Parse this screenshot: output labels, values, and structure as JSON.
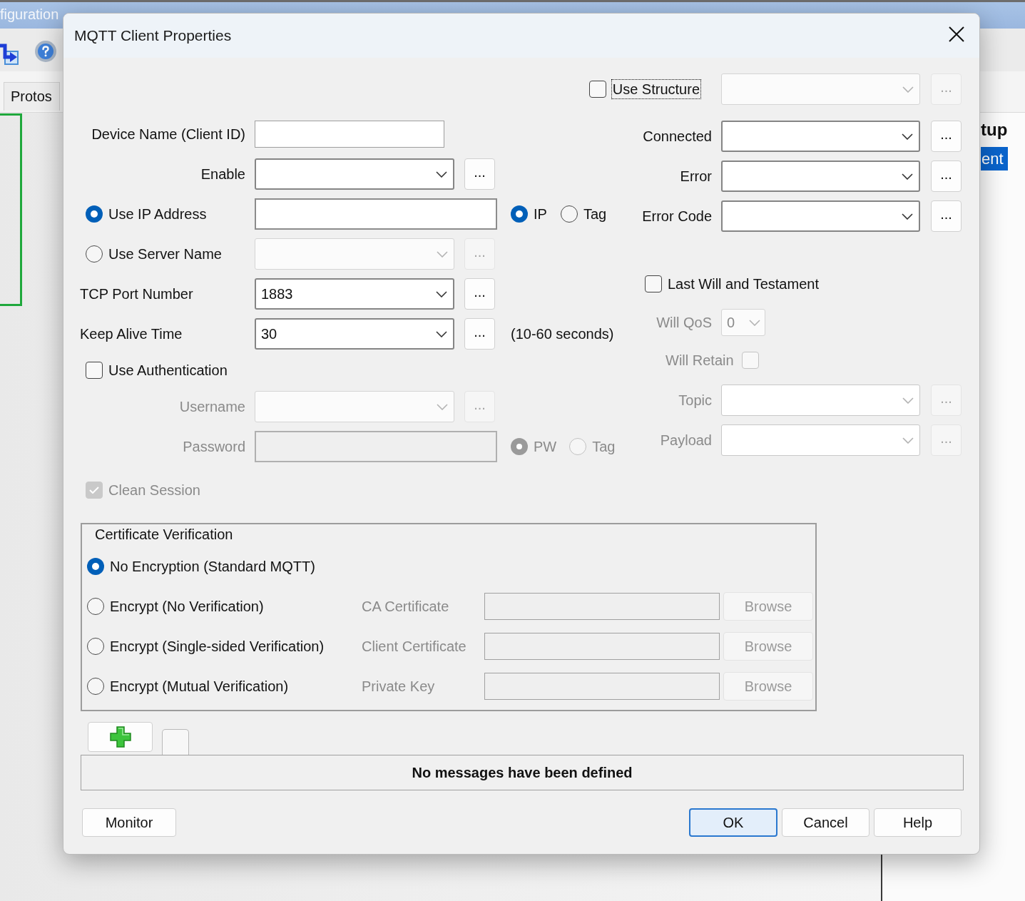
{
  "app": {
    "title": "figuration",
    "tab": "Protos",
    "panel": {
      "heading": "tup",
      "items": [
        {
          "label": "ent",
          "selected": true
        }
      ]
    }
  },
  "dialog": {
    "title": "MQTT Client Properties"
  },
  "use_structure": {
    "label": "Use Structure",
    "checked": false,
    "focused": true,
    "disabled": true,
    "browse": "..."
  },
  "device_name": {
    "label": "Device Name (Client ID)"
  },
  "enable": {
    "label": "Enable",
    "disabled": false,
    "browse": "..."
  },
  "address_mode": [
    {
      "label": "Use IP Address",
      "selected": true
    },
    {
      "label": "Use Server Name",
      "selected": false
    }
  ],
  "ip_address": {
    "format": [
      {
        "label": "IP",
        "selected": true
      },
      {
        "label": "Tag",
        "selected": false
      }
    ]
  },
  "server_name": {
    "disabled": true,
    "browse": "..."
  },
  "tcp_port": {
    "label": "TCP Port Number",
    "value": "1883",
    "disabled": false,
    "browse": "..."
  },
  "keep_alive": {
    "label": "Keep Alive Time",
    "value": "30",
    "disabled": false,
    "browse": "...",
    "hint": "(10-60 seconds)"
  },
  "use_authentication": {
    "label": "Use Authentication",
    "checked": false
  },
  "username": {
    "label": "Username",
    "disabled": true,
    "browse": "..."
  },
  "password": {
    "label": "Password",
    "disabled": true,
    "format": [
      {
        "label": "PW",
        "selected": true
      },
      {
        "label": "Tag",
        "selected": false
      }
    ]
  },
  "clean_session": {
    "label": "Clean Session",
    "checked": true,
    "disabled": true
  },
  "status_tags": [
    {
      "label": "Connected",
      "disabled": false,
      "browse": "..."
    },
    {
      "label": "Error",
      "disabled": false,
      "browse": "..."
    },
    {
      "label": "Error Code",
      "disabled": false,
      "browse": "..."
    }
  ],
  "last_will": {
    "label": "Last Will and Testament",
    "checked": false
  },
  "will_qos": {
    "label": "Will QoS",
    "value": "0",
    "disabled": true
  },
  "will_retain": {
    "label": "Will Retain",
    "checked": false,
    "disabled": true
  },
  "will_fields": [
    {
      "label": "Topic",
      "disabled": true,
      "browse": "..."
    },
    {
      "label": "Payload",
      "disabled": true,
      "browse": "..."
    }
  ],
  "certificate": {
    "title": "Certificate Verification",
    "options": [
      {
        "label": "No Encryption (Standard MQTT)",
        "selected": true
      },
      {
        "label": "Encrypt (No Verification)",
        "selected": false,
        "file": {
          "label": "CA Certificate",
          "button": "Browse",
          "disabled": true
        }
      },
      {
        "label": "Encrypt (Single-sided Verification)",
        "selected": false,
        "file": {
          "label": "Client Certificate",
          "button": "Browse",
          "disabled": true
        }
      },
      {
        "label": "Encrypt (Mutual Verification)",
        "selected": false,
        "file": {
          "label": "Private Key",
          "button": "Browse",
          "disabled": true
        }
      }
    ]
  },
  "messages": {
    "empty_text": "No messages have been defined"
  },
  "footer": {
    "left": [
      {
        "label": "Monitor",
        "default": false
      }
    ],
    "right": [
      {
        "label": "OK",
        "default": true
      },
      {
        "label": "Cancel",
        "default": false
      },
      {
        "label": "Help",
        "default": false
      }
    ]
  }
}
